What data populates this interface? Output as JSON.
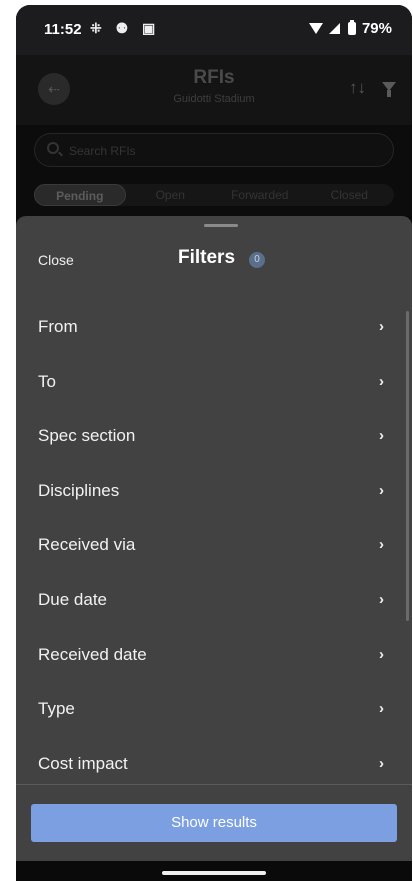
{
  "status_bar": {
    "time": "11:52",
    "notification_icons": "⁜ ⚉ ▣",
    "battery_percent": "79%"
  },
  "header": {
    "back_icon": "⇠",
    "title": "RFIs",
    "subtitle": "Guidotti Stadium",
    "sort_icon": "↑↓"
  },
  "search": {
    "placeholder": "Search RFIs"
  },
  "tabs": [
    "Pending",
    "Open",
    "Forwarded",
    "Closed"
  ],
  "sheet": {
    "close_label": "Close",
    "title": "Filters",
    "active_count": "0",
    "filters": [
      "From",
      "To",
      "Spec section",
      "Disciplines",
      "Received via",
      "Due date",
      "Received date",
      "Type",
      "Cost impact"
    ],
    "chevron": "›",
    "show_results_label": "Show results",
    "button_color": "#7b9fe0"
  }
}
